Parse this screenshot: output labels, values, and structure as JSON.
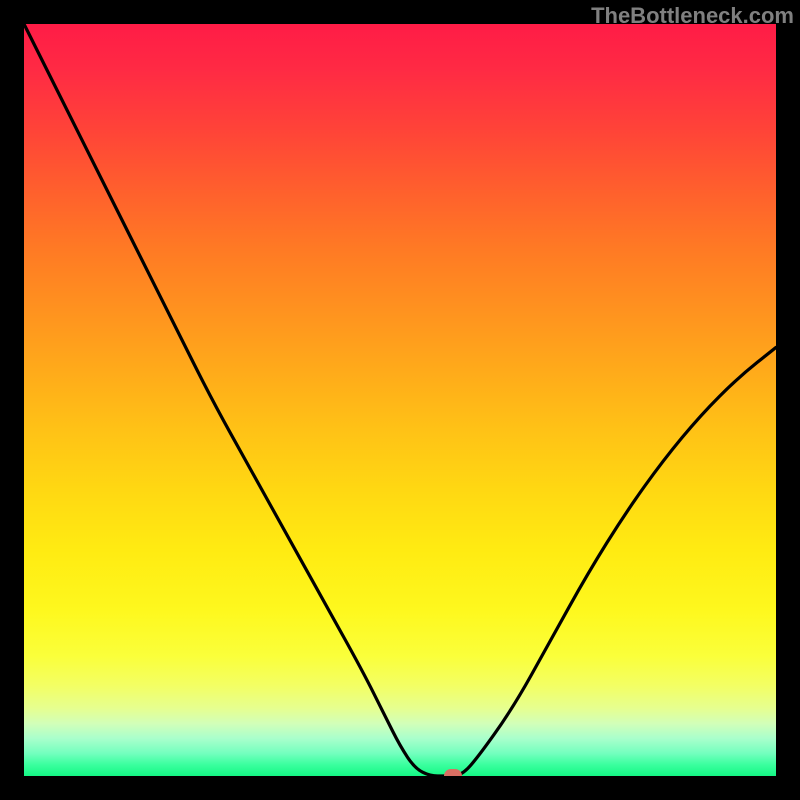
{
  "watermark": "TheBottleneck.com",
  "chart_data": {
    "type": "line",
    "title": "",
    "xlabel": "",
    "ylabel": "",
    "xlim": [
      0,
      100
    ],
    "ylim": [
      0,
      100
    ],
    "x": [
      0,
      5,
      10,
      15,
      20,
      25,
      30,
      35,
      40,
      45,
      48,
      50,
      52,
      54,
      56,
      58,
      60,
      65,
      70,
      75,
      80,
      85,
      90,
      95,
      100
    ],
    "values": [
      100,
      90,
      80,
      70,
      60,
      50,
      41,
      32,
      23,
      14,
      8,
      4,
      1,
      0,
      0,
      0,
      2,
      9,
      18,
      27,
      35,
      42,
      48,
      53,
      57
    ],
    "marker": {
      "x": 57,
      "y": 0
    },
    "background": "heat-gradient-red-to-green"
  }
}
